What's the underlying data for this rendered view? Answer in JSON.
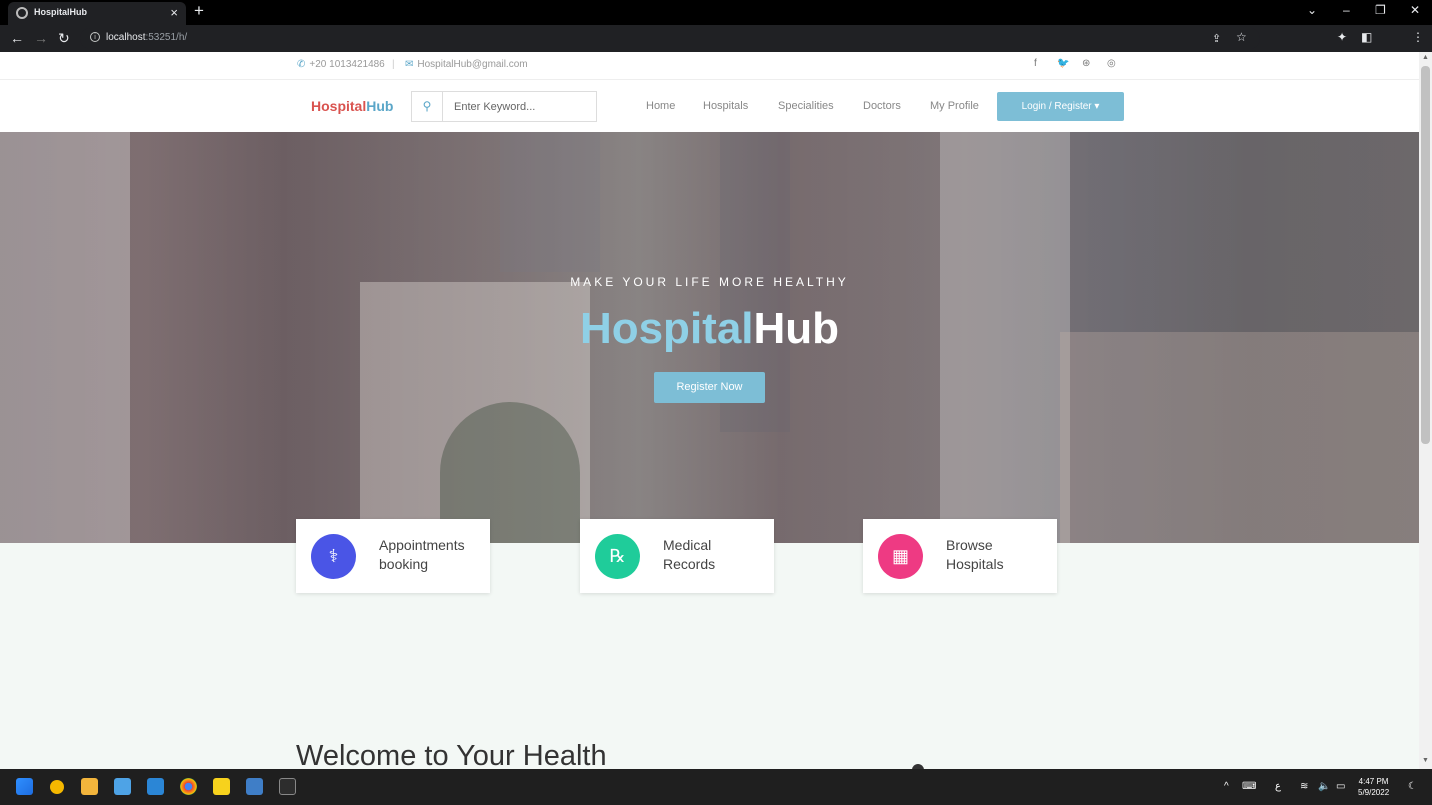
{
  "browser": {
    "tab_title": "HospitalHub",
    "tab_close": "×",
    "new_tab": "+",
    "url_host": "localhost",
    "url_rest": ":53251/h/",
    "window_controls": [
      "⌄",
      "–",
      "❐",
      "✕"
    ]
  },
  "topbar": {
    "phone": "+20 1013421486",
    "separator": "|",
    "email": "HospitalHub@gmail.com",
    "social_icons": [
      "facebook-icon",
      "twitter-icon",
      "dribbble-icon",
      "instagram-icon"
    ],
    "social_glyphs": [
      "f",
      "🐦",
      "⊛",
      "◎"
    ]
  },
  "navbar": {
    "brand_part1": "Hospital",
    "brand_part2": "Hub",
    "search_placeholder": "Enter Keyword...",
    "links": [
      "Home",
      "Hospitals",
      "Specialities",
      "Doctors",
      "My Profile"
    ],
    "login_label": "Login / Register ▾"
  },
  "hero": {
    "tagline": "MAKE YOUR LIFE MORE HEALTHY",
    "title_part1": "Hospital",
    "title_part2": "Hub",
    "register_label": "Register Now"
  },
  "cards": [
    {
      "line1": "Appointments",
      "line2": "booking",
      "icon": "doctor-icon",
      "color": "#4a55e6"
    },
    {
      "line1": "Medical",
      "line2": "Records",
      "icon": "prescription-icon",
      "color": "#1fcc9a"
    },
    {
      "line1": "Browse",
      "line2": "Hospitals",
      "icon": "hospital-icon",
      "color": "#ee3a83"
    }
  ],
  "welcome": "Welcome to Your Health",
  "taskbar": {
    "clock_time": "4:47 PM",
    "clock_date": "5/9/2022",
    "lang": "ع"
  },
  "colors": {
    "accent": "#7dbed6",
    "brand_red": "#d9534f",
    "brand_blue": "#5aa6c8"
  }
}
